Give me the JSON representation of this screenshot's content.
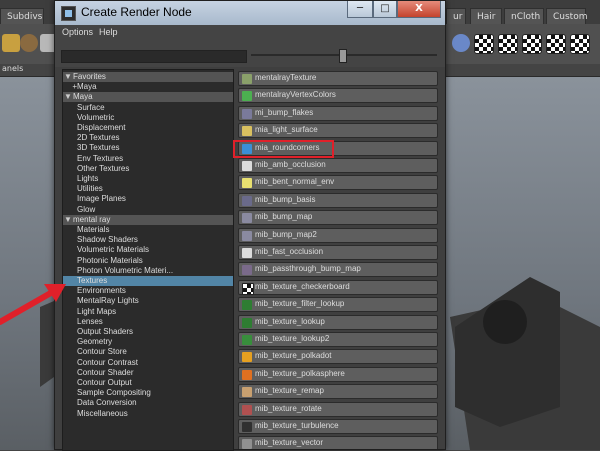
{
  "background": {
    "shelf_tabs": [
      "Subdivs",
      "ur",
      "Hair",
      "nCloth",
      "Custom"
    ],
    "panel_label": "anels"
  },
  "dialog": {
    "title": "Create Render Node",
    "window_buttons": {
      "minimize": "─",
      "maximize": "□",
      "close": "X"
    },
    "menu": [
      "Options",
      "Help"
    ]
  },
  "tree": {
    "rows": [
      {
        "label": "Favorites",
        "type": "header",
        "arrow": "▼"
      },
      {
        "label": "Maya",
        "type": "item",
        "indent": "+ "
      },
      {
        "label": "Maya",
        "type": "header",
        "arrow": "▼"
      },
      {
        "label": "Surface",
        "type": "item"
      },
      {
        "label": "Volumetric",
        "type": "item"
      },
      {
        "label": "Displacement",
        "type": "item"
      },
      {
        "label": "2D Textures",
        "type": "item"
      },
      {
        "label": "3D Textures",
        "type": "item"
      },
      {
        "label": "Env Textures",
        "type": "item"
      },
      {
        "label": "Other Textures",
        "type": "item"
      },
      {
        "label": "Lights",
        "type": "item"
      },
      {
        "label": "Utilities",
        "type": "item"
      },
      {
        "label": "Image Planes",
        "type": "item"
      },
      {
        "label": "Glow",
        "type": "item"
      },
      {
        "label": "mental ray",
        "type": "header",
        "arrow": "▼"
      },
      {
        "label": "Materials",
        "type": "item"
      },
      {
        "label": "Shadow Shaders",
        "type": "item"
      },
      {
        "label": "Volumetric Materials",
        "type": "item"
      },
      {
        "label": "Photonic Materials",
        "type": "item"
      },
      {
        "label": "Photon Volumetric Materi...",
        "type": "item"
      },
      {
        "label": "Textures",
        "type": "selected"
      },
      {
        "label": "Environments",
        "type": "item"
      },
      {
        "label": "MentalRay Lights",
        "type": "item"
      },
      {
        "label": "Light Maps",
        "type": "item"
      },
      {
        "label": "Lenses",
        "type": "item"
      },
      {
        "label": "Output Shaders",
        "type": "item"
      },
      {
        "label": "Geometry",
        "type": "item"
      },
      {
        "label": "Contour Store",
        "type": "item"
      },
      {
        "label": "Contour Contrast",
        "type": "item"
      },
      {
        "label": "Contour Shader",
        "type": "item"
      },
      {
        "label": "Contour Output",
        "type": "item"
      },
      {
        "label": "Sample Compositing",
        "type": "item"
      },
      {
        "label": "Data Conversion",
        "type": "item"
      },
      {
        "label": "Miscellaneous",
        "type": "item"
      }
    ]
  },
  "nodes": [
    {
      "label": "mentalrayTexture",
      "icon_color": "#8aa06a"
    },
    {
      "label": "mentalrayVertexColors",
      "icon_color": "#4caf50"
    },
    {
      "label": "mi_bump_flakes",
      "icon_color": "#7a7a9a"
    },
    {
      "label": "mia_light_surface",
      "icon_color": "#d8c060"
    },
    {
      "label": "mia_roundcorners",
      "icon_color": "#3b8fd6"
    },
    {
      "label": "mib_amb_occlusion",
      "icon_color": "#dcdcdc"
    },
    {
      "label": "mib_bent_normal_env",
      "icon_color": "#e8e070"
    },
    {
      "label": "mib_bump_basis",
      "icon_color": "#6a6a8a"
    },
    {
      "label": "mib_bump_map",
      "icon_color": "#8a8aa0"
    },
    {
      "label": "mib_bump_map2",
      "icon_color": "#8a8aa0"
    },
    {
      "label": "mib_fast_occlusion",
      "icon_color": "#dcdcdc"
    },
    {
      "label": "mib_passthrough_bump_map",
      "icon_color": "#7a6a8a"
    },
    {
      "label": "mib_texture_checkerboard",
      "icon_color": "checker"
    },
    {
      "label": "mib_texture_filter_lookup",
      "icon_color": "#2e7d32"
    },
    {
      "label": "mib_texture_lookup",
      "icon_color": "#2e7d32"
    },
    {
      "label": "mib_texture_lookup2",
      "icon_color": "#388e3c"
    },
    {
      "label": "mib_texture_polkadot",
      "icon_color": "#e6a020"
    },
    {
      "label": "mib_texture_polkasphere",
      "icon_color": "#e07020"
    },
    {
      "label": "mib_texture_remap",
      "icon_color": "#c8a070"
    },
    {
      "label": "mib_texture_rotate",
      "icon_color": "#b05050"
    },
    {
      "label": "mib_texture_turbulence",
      "icon_color": "#303030"
    },
    {
      "label": "mib_texture_vector",
      "icon_color": "#909090"
    }
  ],
  "highlight_color": "#e0202a",
  "selection_color": "#5285a6"
}
